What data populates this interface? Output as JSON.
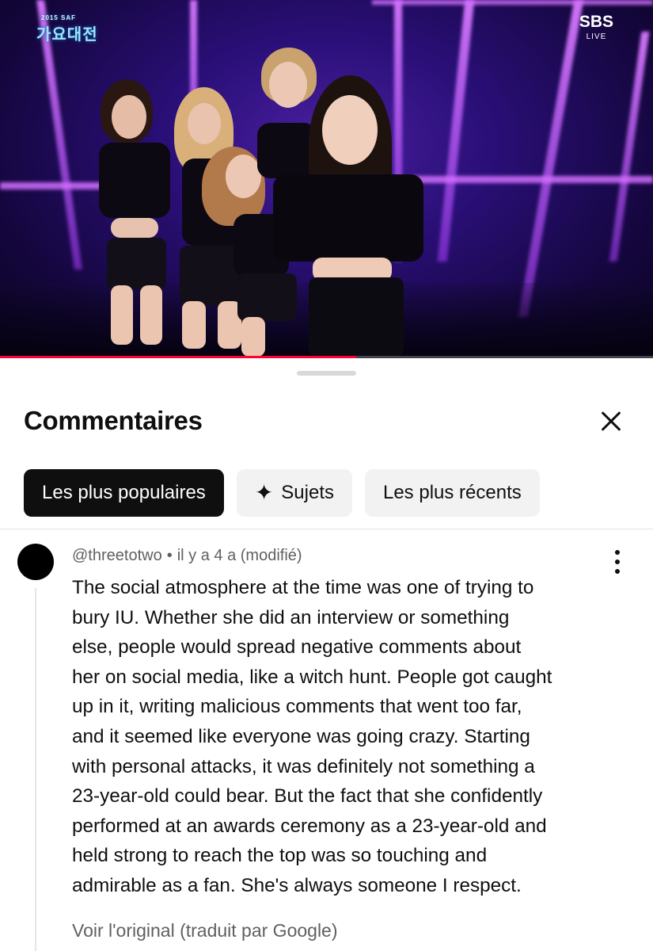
{
  "video": {
    "channel_logo_text": "가요대전",
    "channel_logo_year": "2015 SAF",
    "broadcaster": "SBS",
    "broadcaster_sub": "LIVE",
    "progress_fraction": 0.545
  },
  "sheet": {
    "title": "Commentaires",
    "close_icon": "close-icon"
  },
  "filters": [
    {
      "label": "Les plus populaires",
      "active": true
    },
    {
      "label": "Sujets",
      "icon": "sparkle-icon",
      "active": false
    },
    {
      "label": "Les plus récents",
      "active": false
    }
  ],
  "comment": {
    "author": "@threetotwo",
    "separator": "•",
    "time": "il y a 4 a (modifié)",
    "lines": [
      "The social atmosphere at the time was one of trying to",
      "bury IU. Whether she did an interview or something",
      "else, people would spread negative comments about",
      "her on social media, like a witch hunt. People got caught",
      "up in it, writing malicious comments that went too far,",
      "and it seemed like everyone was going crazy. Starting",
      "with personal attacks, it was definitely not something a",
      "23-year-old could bear. But the fact that she confidently",
      "performed at an awards ceremony as a 23-year-old and",
      "held strong to reach the top was so touching and",
      "admirable as a fan. She's always someone I respect."
    ],
    "translate_link": "Voir l'original (traduit par Google)"
  },
  "colors": {
    "text_primary": "#0f0f0f",
    "text_secondary": "#606060",
    "chip_bg": "#f2f2f2",
    "chip_active_bg": "#0f0f0f",
    "progress": "#ff0033"
  }
}
